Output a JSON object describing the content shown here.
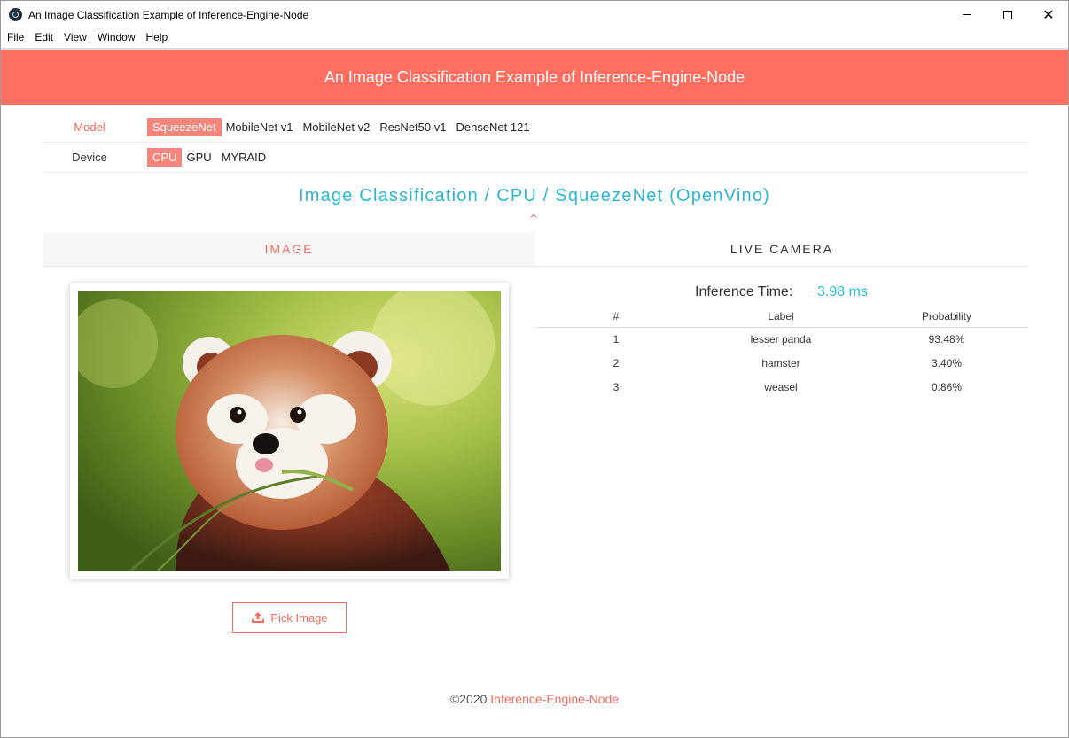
{
  "window": {
    "title": "An Image Classification Example of Inference-Engine-Node"
  },
  "menu": [
    "File",
    "Edit",
    "View",
    "Window",
    "Help"
  ],
  "header": {
    "title": "An Image Classification Example of Inference-Engine-Node"
  },
  "model": {
    "label": "Model",
    "options": [
      "SqueezeNet",
      "MobileNet v1",
      "MobileNet v2",
      "ResNet50 v1",
      "DenseNet 121"
    ],
    "selected": "SqueezeNet"
  },
  "device": {
    "label": "Device",
    "options": [
      "CPU",
      "GPU",
      "MYRAID"
    ],
    "selected": "CPU"
  },
  "subtitle": "Image Classification / CPU / SqueezeNet (OpenVino)",
  "tabs": {
    "image": "IMAGE",
    "camera": "LIVE CAMERA",
    "active": "IMAGE"
  },
  "pick_button": {
    "label": "Pick Image"
  },
  "inference": {
    "label": "Inference Time:",
    "value": "3.98 ms"
  },
  "results": {
    "headers": [
      "#",
      "Label",
      "Probability"
    ],
    "rows": [
      {
        "rank": "1",
        "label": "lesser panda",
        "prob": "93.48%"
      },
      {
        "rank": "2",
        "label": "hamster",
        "prob": "3.40%"
      },
      {
        "rank": "3",
        "label": "weasel",
        "prob": "0.86%"
      }
    ]
  },
  "footer": {
    "copyright": "©2020",
    "link": "Inference-Engine-Node"
  },
  "colors": {
    "accent": "#ff6f61",
    "accent_text": "#f36b5d",
    "chip_selected": "#f5857a",
    "cyan": "#2bb7d6"
  }
}
